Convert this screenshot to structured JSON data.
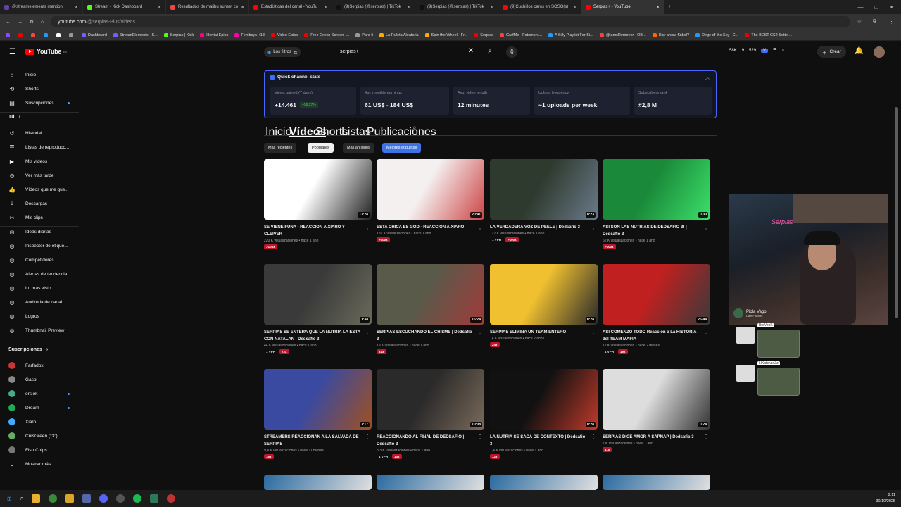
{
  "browser": {
    "tabs": [
      {
        "label": "@streamelements mention",
        "color": "#6441a5"
      },
      {
        "label": "Stream - Kick Dashboard",
        "color": "#53fc18"
      },
      {
        "label": "Resultados de malibu sunset co",
        "color": "#e44"
      },
      {
        "label": "Estadísticas del canal - YouTu",
        "color": "#f00"
      },
      {
        "label": "(9)Serpias (@serpias) | TikTok",
        "color": "#111"
      },
      {
        "label": "(9)Serpias (@serpias) | TikTok",
        "color": "#111"
      },
      {
        "label": "(9)Cuchillos caros en SOSO(s)",
        "color": "#f00"
      },
      {
        "label": "Serpias+ - YouTube",
        "color": "#f00",
        "active": true
      }
    ],
    "url_host": "youtube.com",
    "url_path": "/@serpias-Plus/videos",
    "bookmarks": [
      {
        "label": "",
        "color": "#9146ff"
      },
      {
        "label": "",
        "color": "#e00"
      },
      {
        "label": "",
        "color": "#f44"
      },
      {
        "label": "",
        "color": "#29f"
      },
      {
        "label": "",
        "color": "#fff"
      },
      {
        "label": "",
        "color": "#999"
      },
      {
        "label": "Dashboard",
        "color": "#7b5cff"
      },
      {
        "label": "StreamElements - S...",
        "color": "#7b5cff"
      },
      {
        "label": "Serpias | Kick",
        "color": "#53fc18"
      },
      {
        "label": "Hentai Epico",
        "color": "#f08"
      },
      {
        "label": "Femboys +18",
        "color": "#f0a"
      },
      {
        "label": "Video Epico",
        "color": "#e00"
      },
      {
        "label": "Free Green Screen -...",
        "color": "#e00"
      },
      {
        "label": "Para ti",
        "color": "#999"
      },
      {
        "label": "La Ruleta Aleatoria",
        "color": "#fa0"
      },
      {
        "label": "Spin the Wheel - Fr...",
        "color": "#fa0"
      },
      {
        "label": "Serpias",
        "color": "#e00"
      },
      {
        "label": "GrafMe - Fotomont...",
        "color": "#e44"
      },
      {
        "label": "A Silly Playlist For Si...",
        "color": "#29f"
      },
      {
        "label": "@jamsRemover - OB...",
        "color": "#e44"
      },
      {
        "label": "Hay ahora fútbol?",
        "color": "#f60"
      },
      {
        "label": "Dirge of the Sky | C...",
        "color": "#29f"
      },
      {
        "label": "The BEST CS2 Settin...",
        "color": "#e00"
      }
    ]
  },
  "header": {
    "logo_text": "YouTube",
    "logo_sup": "ES",
    "filters_label": "Los filtros",
    "search_value": "serpias+",
    "top_stats": [
      "58K",
      "9",
      "529"
    ],
    "create_label": "Crear"
  },
  "sidebar": {
    "main": [
      {
        "label": "Inicio",
        "icon": "⌂"
      },
      {
        "label": "Shorts",
        "icon": "⟲"
      },
      {
        "label": "Suscripciones",
        "icon": "▤",
        "dot": true
      }
    ],
    "you_heading": "Tú",
    "you": [
      {
        "label": "Historial",
        "icon": "↺"
      },
      {
        "label": "Listas de reproducc...",
        "icon": "☰"
      },
      {
        "label": "Mis vídeos",
        "icon": "▶"
      },
      {
        "label": "Ver más tarde",
        "icon": "◷"
      },
      {
        "label": "Vídeos que me gus...",
        "icon": "👍"
      },
      {
        "label": "Descargas",
        "icon": "⤓"
      },
      {
        "label": "Mis clips",
        "icon": "✂"
      }
    ],
    "tools": [
      {
        "label": "Ideas diarias"
      },
      {
        "label": "Inspector de etique..."
      },
      {
        "label": "Competidores"
      },
      {
        "label": "Alertas de tendencia"
      },
      {
        "label": "Lo más visto"
      },
      {
        "label": "Auditoria de canal"
      },
      {
        "label": "Logros"
      },
      {
        "label": "Thumbnail Preview"
      }
    ],
    "subs_heading": "Suscripciones",
    "subs": [
      {
        "label": "Farfadox",
        "color": "#c33"
      },
      {
        "label": "Gaspi",
        "color": "#888"
      },
      {
        "label": "orslok",
        "color": "#4a8",
        "dot": true
      },
      {
        "label": "Dream",
        "color": "#2a5",
        "dot": true
      },
      {
        "label": "Xiaro",
        "color": "#4af"
      },
      {
        "label": "CriisGreen (ᵔ3ᵔ)",
        "color": "#6a6"
      },
      {
        "label": "Fish Chips",
        "color": "#777"
      }
    ],
    "more_label": "Mostrar más"
  },
  "stats": {
    "title": "Quick channel stats",
    "cols": [
      {
        "label": "Views gained (7 days)",
        "value": "+14.461",
        "pct": "+58,27%"
      },
      {
        "label": "Est. monthly earnings",
        "value": "61 US$ - 184 US$"
      },
      {
        "label": "Avg. video length",
        "value": "12 minutes"
      },
      {
        "label": "Upload frequency",
        "value": "~1 uploads per week"
      },
      {
        "label": "Subscribers rank",
        "value": "#2,8 M"
      }
    ]
  },
  "channel_tabs": [
    "Inicio",
    "Vídeos",
    "Shorts",
    "Listas",
    "Publicaciones"
  ],
  "sort_chips": [
    "Más recientes",
    "Populares",
    "Más antiguos",
    "Mejores etiquetas"
  ],
  "videos": [
    {
      "title": "SE VIENE FUNA - REACCION A XIARO Y CLEIVER",
      "meta": "220 K visualizaciones • hace 1 año",
      "badges": [
        {
          "t": ">100x",
          "red": true
        }
      ],
      "dur": "17:28",
      "bg": [
        "#ffffff",
        "#222222"
      ]
    },
    {
      "title": "ESTA CHICA ES GOD - REACCION A XIARO",
      "meta": "159 K visualizaciones • hace 1 año",
      "badges": [
        {
          "t": ">100x",
          "red": true
        }
      ],
      "dur": "20:41",
      "bg": [
        "#f5f0f0",
        "#c44"
      ]
    },
    {
      "title": "LA VERDADERA VOZ DE PEELE | Dedsafio 3",
      "meta": "127 K visualizaciones • hace 1 año",
      "badges": [
        {
          "t": "1 VPH",
          "red": false
        },
        {
          "t": ">100x",
          "red": true
        }
      ],
      "dur": "0:23",
      "bg": [
        "#2e3a2e",
        "#6a7a8a"
      ]
    },
    {
      "title": "ASI SON LAS NUTRIAS DE DEDSAFIO 3! | Dedsafio 3",
      "meta": "62 K visualizaciones • hace 1 año",
      "badges": [
        {
          "t": ">100x",
          "red": true
        }
      ],
      "dur": "0:30",
      "bg": [
        "#1a8a3a",
        "#3de06a"
      ]
    },
    {
      "title": "SERPIAS SE ENTERA QUE LA NUTRIA LA ESTA CON NATALAN | Dedsafio 3",
      "meta": "44 K visualizaciones • hace 1 año",
      "badges": [
        {
          "t": "1 VPH",
          "red": false
        },
        {
          "t": "72x",
          "red": true
        }
      ],
      "dur": "1:38",
      "bg": [
        "#3a3a3a",
        "#6a6a5a"
      ]
    },
    {
      "title": "SERPIAS ESCUCHANDO EL CHISME | Dedsafio 3",
      "meta": "19 K visualizaciones • hace 1 año",
      "badges": [
        {
          "t": "31x",
          "red": true
        }
      ],
      "dur": "16:24",
      "bg": [
        "#5a5a4a",
        "#a03a3a"
      ]
    },
    {
      "title": "SERPIAS ELIMINA UN TEAM ENTERO",
      "meta": "14 K visualizaciones • hace 2 años",
      "badges": [
        {
          "t": "24x",
          "red": true
        }
      ],
      "dur": "0:28",
      "bg": [
        "#f0c030",
        "#2a2a2a"
      ]
    },
    {
      "title": "ASI COMENZO TODO Reacción a La HISTORIA del TEAM MAFIA",
      "meta": "12 K visualizaciones • hace 2 meses",
      "badges": [
        {
          "t": "1 VPH",
          "red": false
        },
        {
          "t": "19x",
          "red": true
        }
      ],
      "dur": "26:44",
      "bg": [
        "#c02020",
        "#3a3a3a"
      ]
    },
    {
      "title": "STREAMERS REACCIONAN A LA SALVADA DE SERPIAS",
      "meta": "9,4 K visualizaciones • hace 11 meses",
      "badges": [
        {
          "t": "15x",
          "red": true
        }
      ],
      "dur": "7:17",
      "bg": [
        "#3a4aa0",
        "#a05020"
      ]
    },
    {
      "title": "REACCIONANDO AL FINAL DE DEDSAFIO | Dedsafio 3",
      "meta": "8,3 K visualizaciones • hace 1 año",
      "badges": [
        {
          "t": "1 VPH",
          "red": false
        },
        {
          "t": "13x",
          "red": true
        }
      ],
      "dur": "10:08",
      "bg": [
        "#2a2a2a",
        "#7a6a5a"
      ]
    },
    {
      "title": "LA NUTRIA SE SACA DE CONTEXTO | Dedsafio 3",
      "meta": "7,4 K visualizaciones • hace 1 año",
      "badges": [
        {
          "t": "12x",
          "red": true
        }
      ],
      "dur": "0:28",
      "bg": [
        "#111111",
        "#c03a2a"
      ]
    },
    {
      "title": "SERPIAS DICE AMOR A SAPNAP | Dedsafio 3",
      "meta": "7 K visualizaciones • hace 1 año",
      "badges": [
        {
          "t": "11x",
          "red": true
        }
      ],
      "dur": "0:24",
      "bg": [
        "#ddd",
        "#333"
      ]
    }
  ],
  "streamer": {
    "name": "Piola Vago",
    "sub": "Dale Flashito"
  },
  "chat": [
    {
      "name": "BrdVooK"
    },
    {
      "name": "LlKatchanZz"
    }
  ],
  "clock": {
    "time": "2:11",
    "date": "30/10/2025"
  }
}
